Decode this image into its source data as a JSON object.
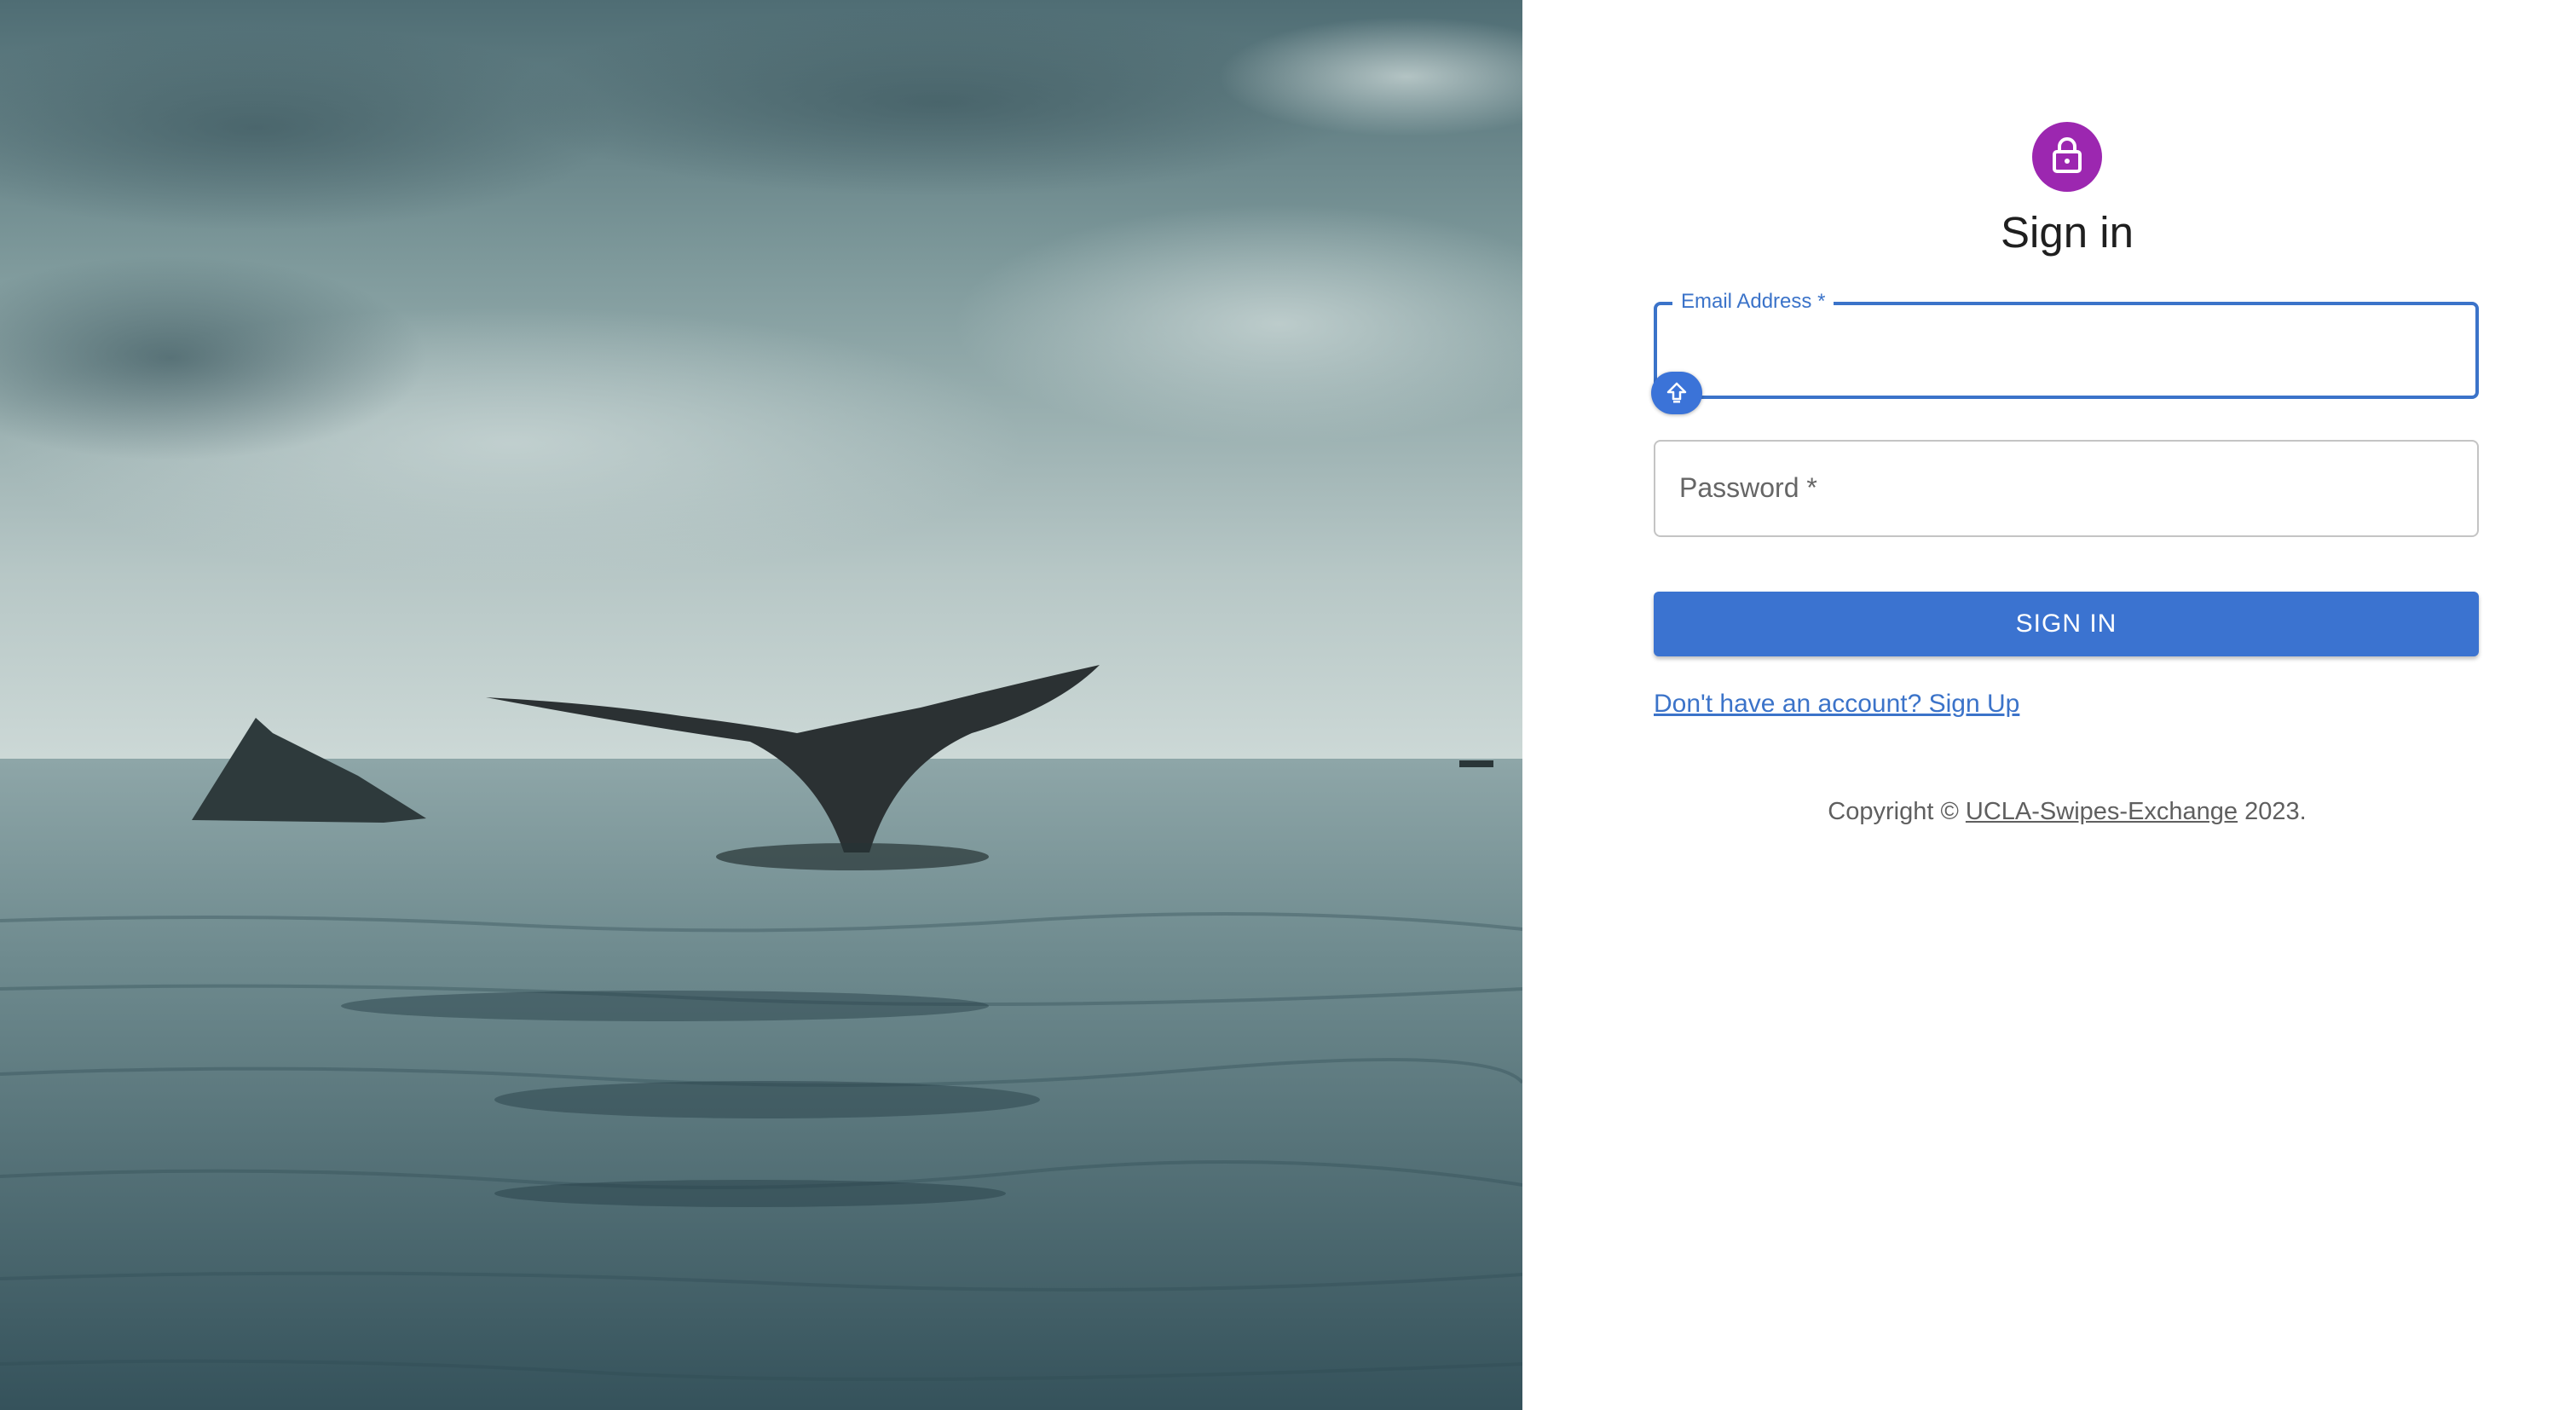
{
  "hero": {
    "icon": "whale-tail-ocean-photo"
  },
  "form": {
    "title": "Sign in",
    "icon": "lock-icon",
    "accent_color": "#9c27b0",
    "primary_color": "#3b73c9",
    "email": {
      "label": "Email Address",
      "required_mark": "*",
      "value": ""
    },
    "password": {
      "label": "Password",
      "required_mark": "*",
      "value": ""
    },
    "submit_label": "SIGN IN",
    "signup_link": "Don't have an account? Sign Up",
    "password_manager_icon": "password-manager-icon"
  },
  "footer": {
    "prefix": "Copyright © ",
    "link": "UCLA-Swipes-Exchange",
    "suffix": " 2023."
  }
}
